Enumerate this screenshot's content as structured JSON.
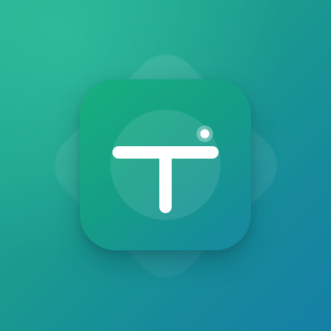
{
  "app_icon": {
    "glyph_icon": "letter-t-icon",
    "accent_dot_icon": "dot-icon",
    "colors": {
      "background_start": "#22ae93",
      "background_end": "#1580a6",
      "icon_start": "#17b07e",
      "icon_end": "#1888a3",
      "glyph": "#ffffff"
    }
  }
}
